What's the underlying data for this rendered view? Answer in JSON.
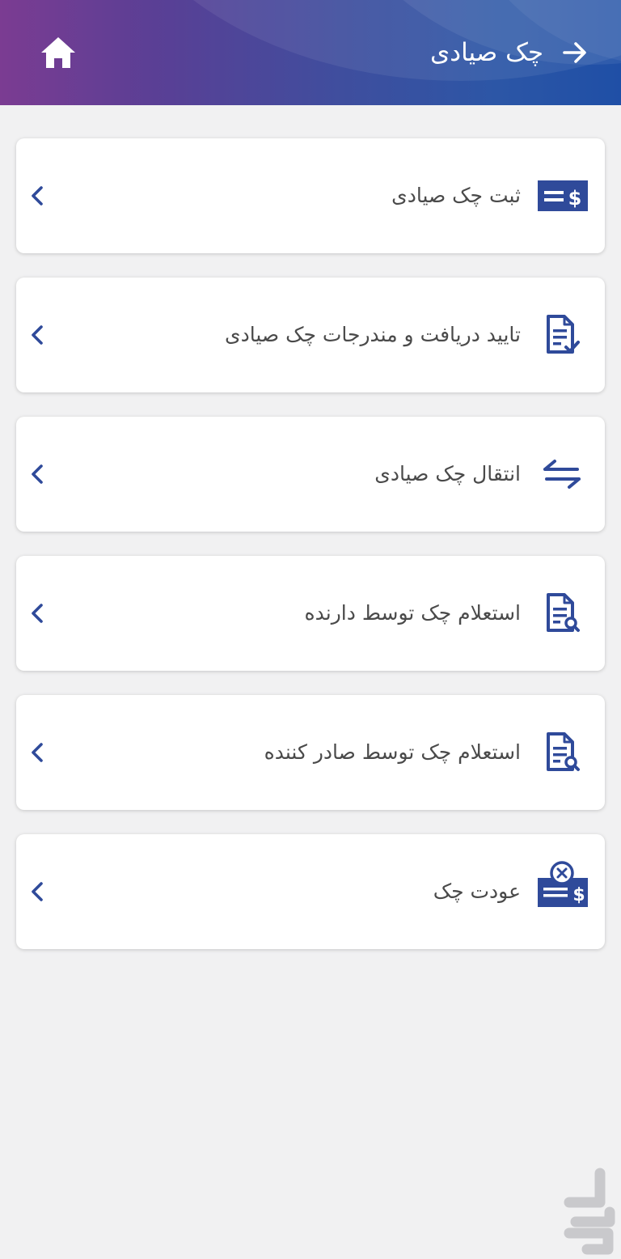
{
  "header": {
    "title": "چک صیادی",
    "home_icon": "home-icon",
    "back_icon": "arrow-right-icon",
    "gradient_colors": [
      "#7b3c92",
      "#3f4e9e",
      "#1f4fa6"
    ]
  },
  "menu": {
    "items": [
      {
        "label": "ثبت چک صیادی",
        "icon": "check-dollar-icon"
      },
      {
        "label": "تایید دریافت و مندرجات چک صیادی",
        "icon": "document-check-icon"
      },
      {
        "label": "انتقال چک صیادی",
        "icon": "transfer-arrows-icon"
      },
      {
        "label": "استعلام چک توسط دارنده",
        "icon": "document-search-icon"
      },
      {
        "label": "استعلام چک توسط صادر کننده",
        "icon": "document-search-icon"
      },
      {
        "label": "عودت چک",
        "icon": "check-return-icon"
      }
    ],
    "chevron_icon": "chevron-left-icon"
  },
  "colors": {
    "accent": "#2f4a9a",
    "background": "#f1f1f2",
    "card": "#ffffff",
    "text": "#4a4a4a"
  },
  "watermark_icon": "bazaar-logo-icon"
}
